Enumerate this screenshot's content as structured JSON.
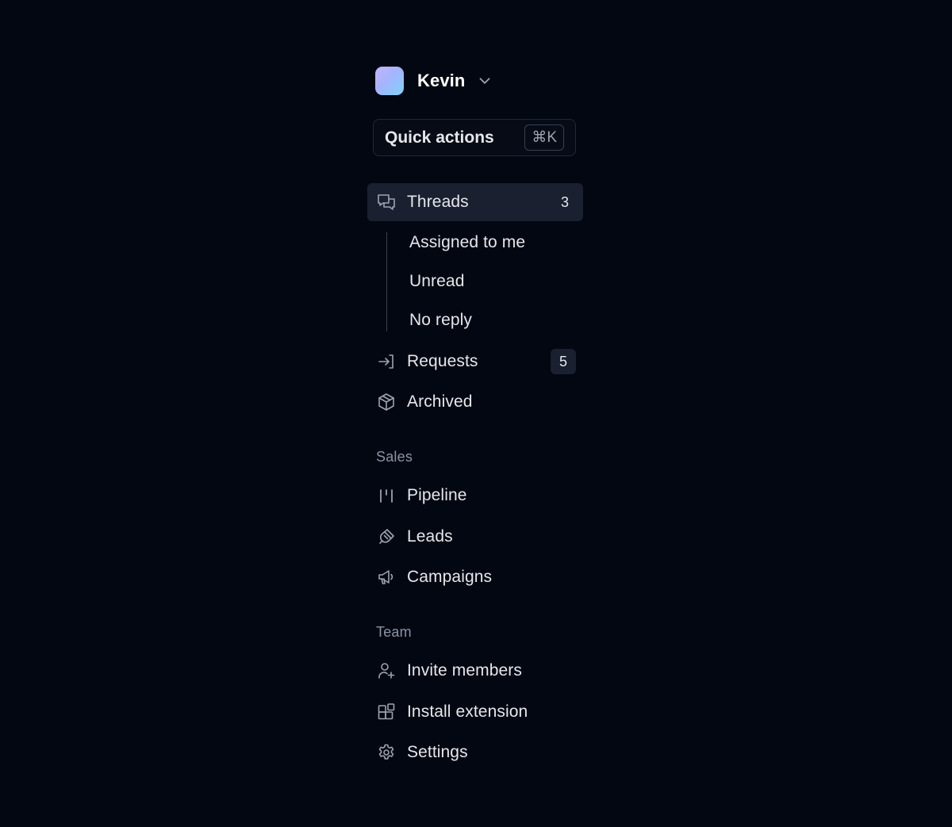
{
  "workspace": {
    "name": "Kevin",
    "avatar_gradient": [
      "#c4b5fd",
      "#7dd3fc"
    ],
    "icon": "chevron-down-icon"
  },
  "quick_actions": {
    "label": "Quick actions",
    "shortcut": "⌘K"
  },
  "nav": {
    "threads": {
      "label": "Threads",
      "count": "3",
      "icon": "chat-bubbles-icon",
      "active": true
    },
    "threads_sub": [
      {
        "label": "Assigned to me"
      },
      {
        "label": "Unread"
      },
      {
        "label": "No reply"
      }
    ],
    "requests": {
      "label": "Requests",
      "count": "5",
      "icon": "arrow-into-box-icon"
    },
    "archived": {
      "label": "Archived",
      "icon": "cube-icon"
    }
  },
  "sales": {
    "title": "Sales",
    "items": [
      {
        "label": "Pipeline",
        "icon": "pipeline-icon"
      },
      {
        "label": "Leads",
        "icon": "magnet-icon"
      },
      {
        "label": "Campaigns",
        "icon": "megaphone-icon"
      }
    ]
  },
  "team": {
    "title": "Team",
    "items": [
      {
        "label": "Invite members",
        "icon": "user-plus-icon"
      },
      {
        "label": "Install extension",
        "icon": "puzzle-squares-icon"
      },
      {
        "label": "Settings",
        "icon": "gear-icon"
      }
    ]
  },
  "colors": {
    "background": "#030712",
    "active_item": "#1a2030",
    "text": "#e5e7eb",
    "muted": "#8b93a3"
  }
}
